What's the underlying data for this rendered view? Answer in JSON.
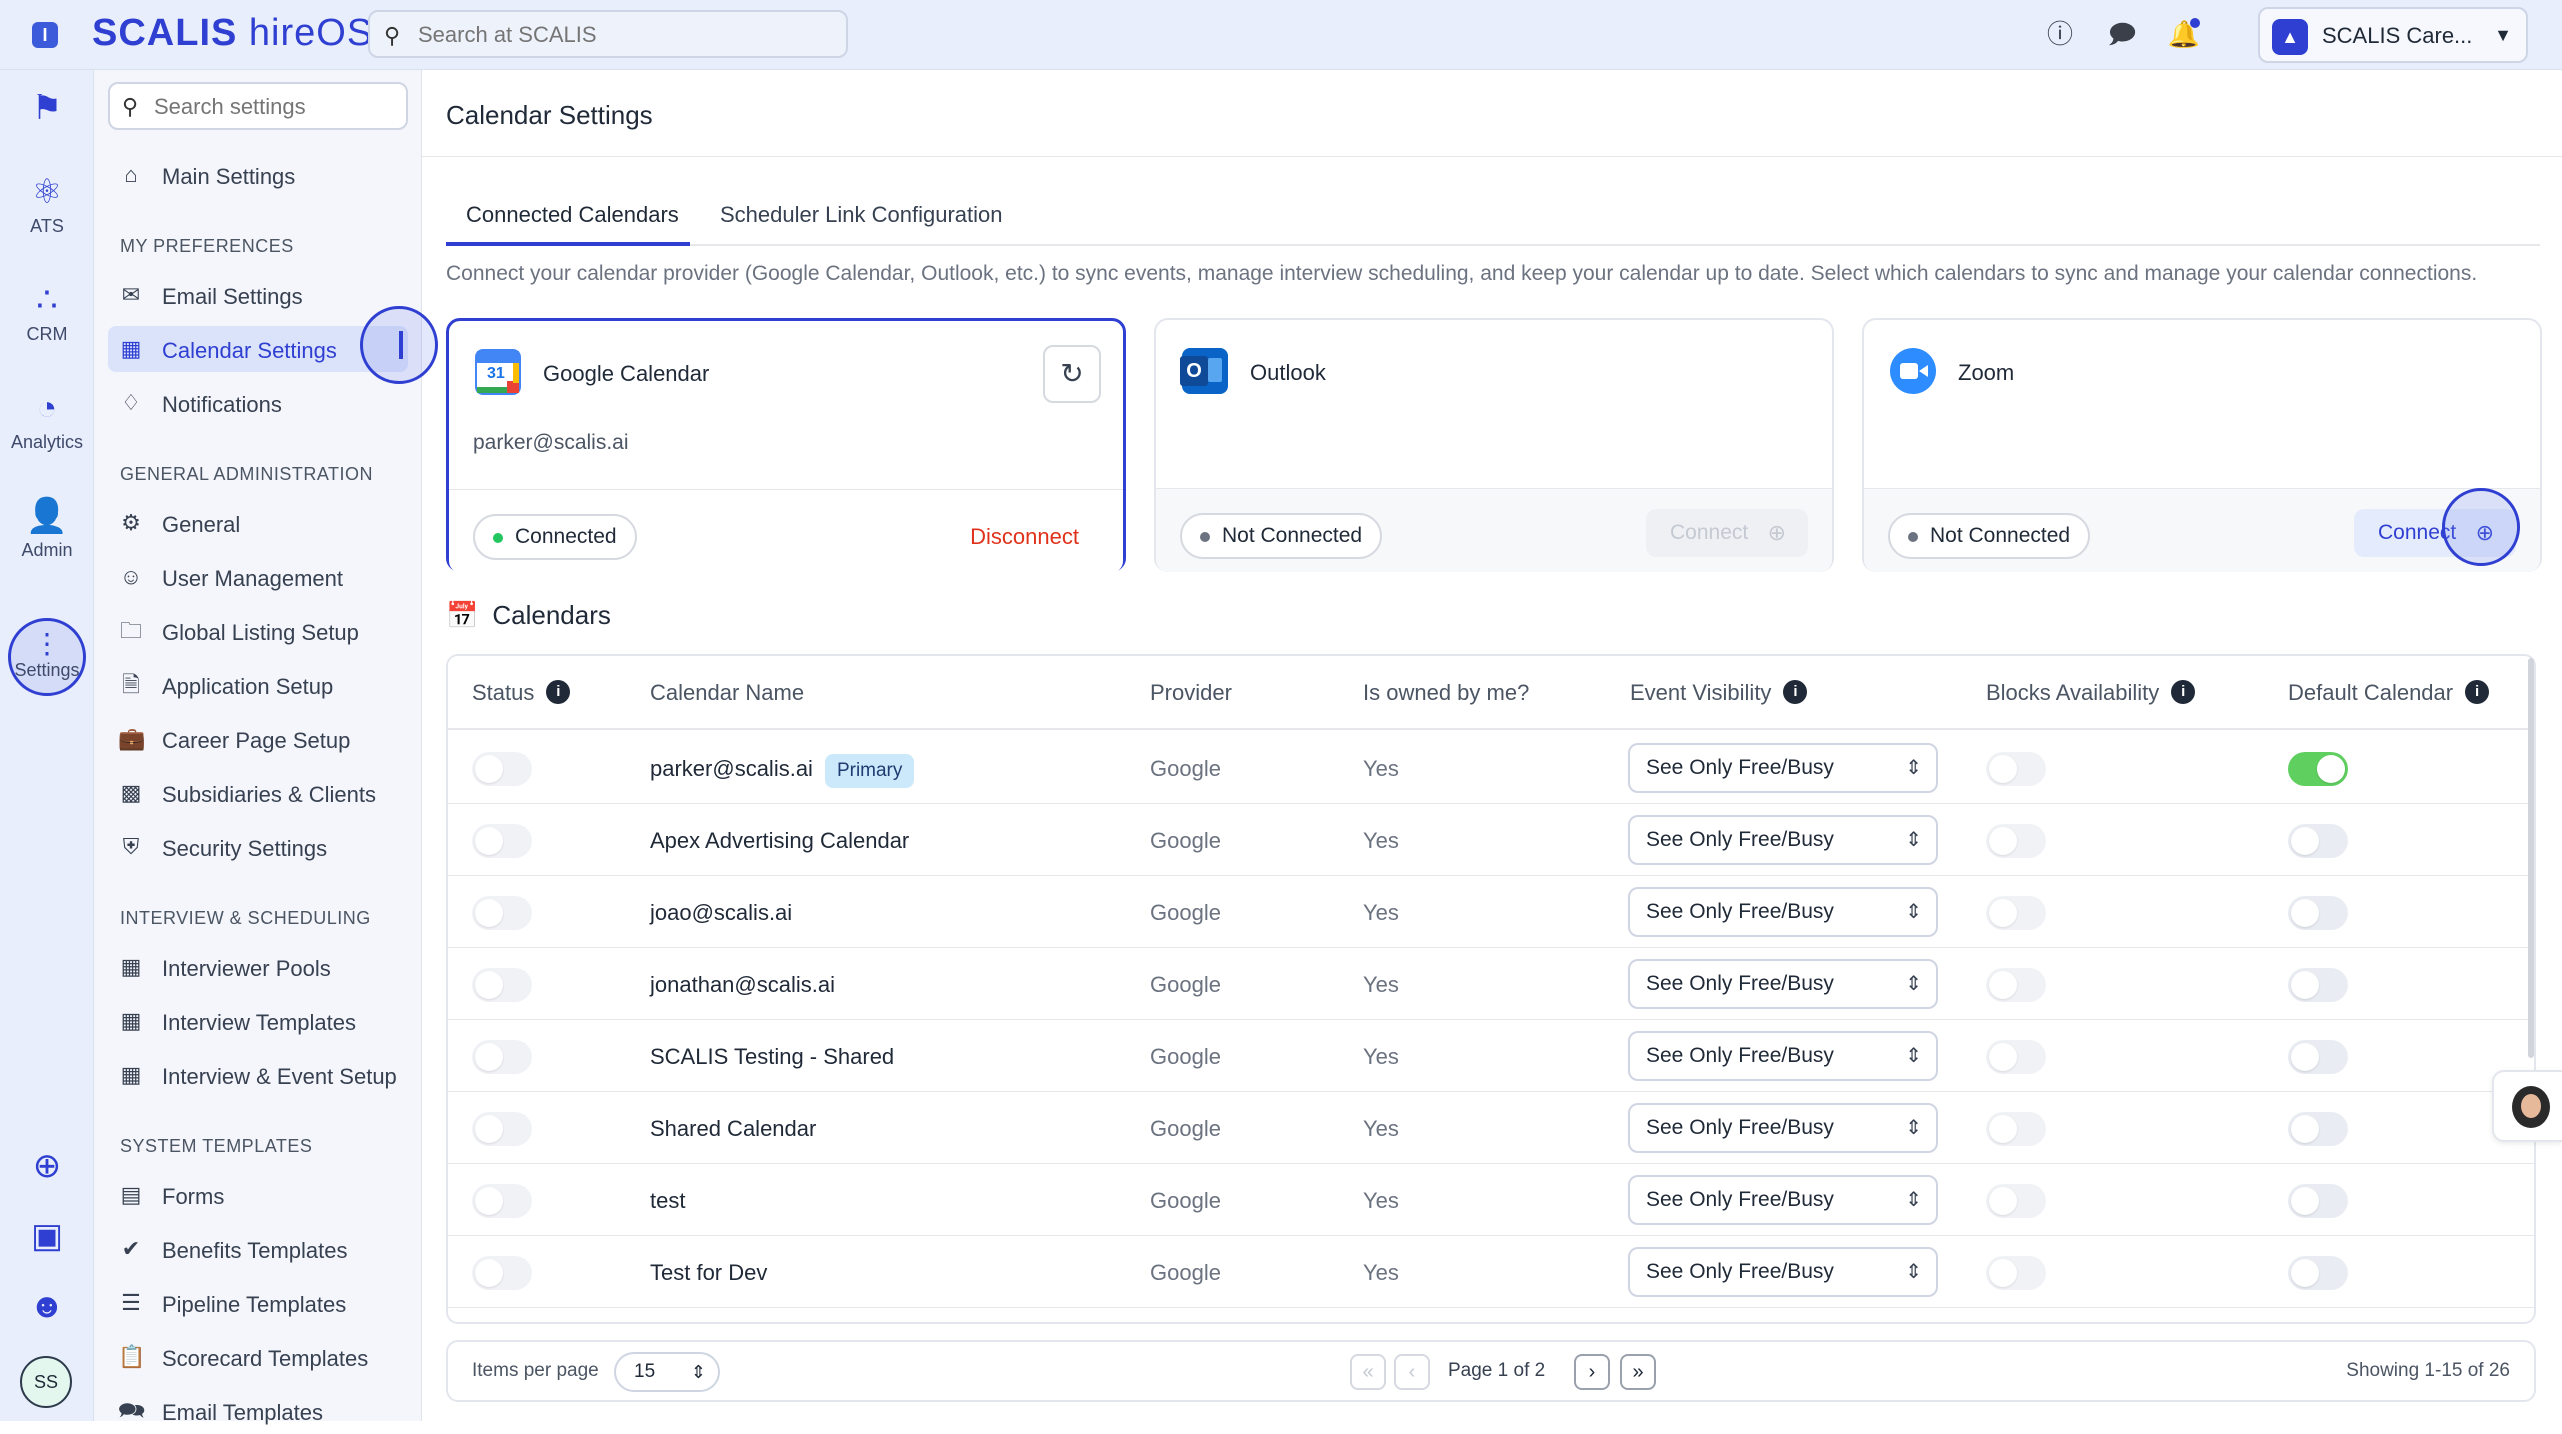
{
  "app": {
    "brand": "SCALIS",
    "brand_suffix": "hireOS",
    "search_placeholder": "Search at SCALIS",
    "account_name": "SCALIS Care...",
    "user_initials": "SS"
  },
  "rail": {
    "items": [
      {
        "label": "",
        "icon": "bookmark-icon"
      },
      {
        "label": "ATS",
        "icon": "atom-icon"
      },
      {
        "label": "CRM",
        "icon": "network-icon"
      },
      {
        "label": "Analytics",
        "icon": "pie-chart-icon"
      },
      {
        "label": "Admin",
        "icon": "admin-user-icon"
      },
      {
        "label": "Settings",
        "icon": "settings-icon"
      }
    ]
  },
  "sidebar": {
    "search_placeholder": "Search settings",
    "main_settings": "Main Settings",
    "sections": [
      {
        "title": "MY PREFERENCES",
        "items": [
          "Email Settings",
          "Calendar Settings",
          "Notifications"
        ]
      },
      {
        "title": "GENERAL ADMINISTRATION",
        "items": [
          "General",
          "User Management",
          "Global Listing Setup",
          "Application Setup",
          "Career Page Setup",
          "Subsidiaries & Clients",
          "Security Settings"
        ]
      },
      {
        "title": "INTERVIEW & SCHEDULING",
        "items": [
          "Interviewer Pools",
          "Interview Templates",
          "Interview & Event Setup"
        ]
      },
      {
        "title": "SYSTEM TEMPLATES",
        "items": [
          "Forms",
          "Benefits Templates",
          "Pipeline Templates",
          "Scorecard Templates",
          "Email Templates"
        ]
      }
    ]
  },
  "main": {
    "title": "Calendar Settings",
    "tabs": [
      "Connected Calendars",
      "Scheduler Link Configuration"
    ],
    "intro": "Connect your calendar provider (Google Calendar, Outlook, etc.) to sync events, manage interview scheduling, and keep your calendar up to date. Select which calendars to sync and manage your calendar connections.",
    "providers": [
      {
        "name": "Google Calendar",
        "email": "parker@scalis.ai",
        "status": "Connected",
        "action": "Disconnect"
      },
      {
        "name": "Outlook",
        "status": "Not Connected",
        "action": "Connect"
      },
      {
        "name": "Zoom",
        "status": "Not Connected",
        "action": "Connect"
      }
    ],
    "calendars_heading": "Calendars",
    "table": {
      "columns": [
        "Status",
        "Calendar Name",
        "Provider",
        "Is owned by me?",
        "Event Visibility",
        "Blocks Availability",
        "Default Calendar"
      ],
      "primary_badge": "Primary",
      "rows": [
        {
          "name": "parker@scalis.ai",
          "provider": "Google",
          "owned": "Yes",
          "visibility": "See Only Free/Busy",
          "status": false,
          "blocks": false,
          "default": true
        },
        {
          "name": "Apex Advertising Calendar",
          "provider": "Google",
          "owned": "Yes",
          "visibility": "See Only Free/Busy",
          "status": false,
          "blocks": false,
          "default": false
        },
        {
          "name": "joao@scalis.ai",
          "provider": "Google",
          "owned": "Yes",
          "visibility": "See Only Free/Busy",
          "status": false,
          "blocks": false,
          "default": false
        },
        {
          "name": "jonathan@scalis.ai",
          "provider": "Google",
          "owned": "Yes",
          "visibility": "See Only Free/Busy",
          "status": false,
          "blocks": false,
          "default": false
        },
        {
          "name": "SCALIS Testing - Shared",
          "provider": "Google",
          "owned": "Yes",
          "visibility": "See Only Free/Busy",
          "status": false,
          "blocks": false,
          "default": false
        },
        {
          "name": "Shared Calendar",
          "provider": "Google",
          "owned": "Yes",
          "visibility": "See Only Free/Busy",
          "status": false,
          "blocks": false,
          "default": false
        },
        {
          "name": "test",
          "provider": "Google",
          "owned": "Yes",
          "visibility": "See Only Free/Busy",
          "status": false,
          "blocks": false,
          "default": false
        },
        {
          "name": "Test for Dev",
          "provider": "Google",
          "owned": "Yes",
          "visibility": "See Only Free/Busy",
          "status": false,
          "blocks": false,
          "default": false
        }
      ]
    },
    "pager": {
      "items_per_page_label": "Items per page",
      "items_per_page": "15",
      "page_info": "Page 1 of 2",
      "showing": "Showing 1-15 of 26"
    }
  },
  "colors": {
    "accent": "#2f3fd1",
    "disconnect": "#e0321a",
    "toggle_on": "#5fcf5f",
    "connected_dot": "#22c55e"
  }
}
